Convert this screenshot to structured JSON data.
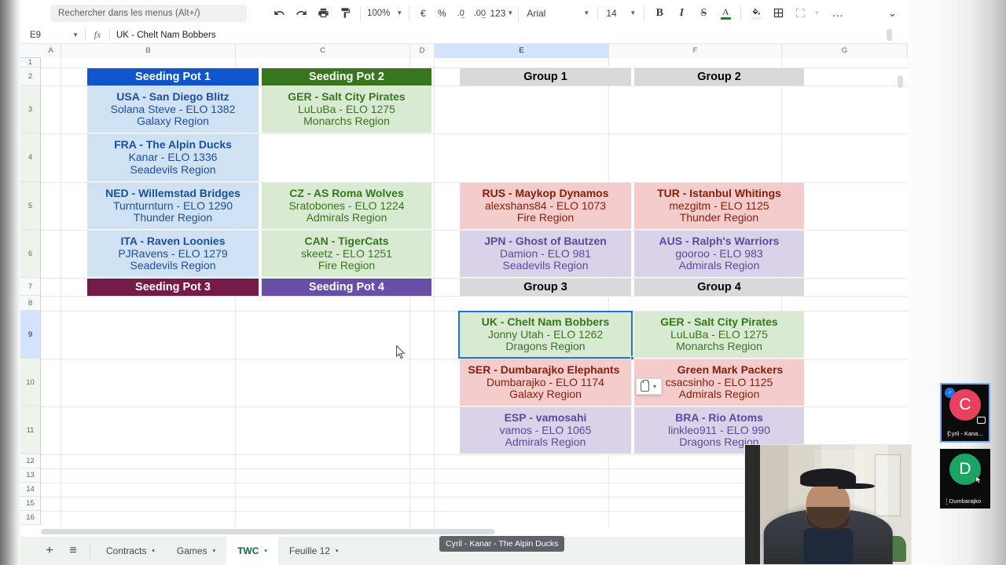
{
  "toolbar": {
    "search_placeholder": "Rechercher dans les menus (Alt+/)",
    "undo": "↶",
    "redo": "↷",
    "print": "print-icon",
    "paint": "paint-format-icon",
    "zoom": "100%",
    "currency": "€",
    "percent": "%",
    "dec_decrease": ".0",
    "dec_increase": ".00",
    "formats": "123",
    "font": "Arial",
    "font_size": "14",
    "bold": "B",
    "italic": "I",
    "strikethrough": "S",
    "text_color": "A",
    "fill_color": "fill-color-icon",
    "borders": "borders-icon",
    "merge": "merge-cells-icon",
    "more": "…",
    "collapse": "⌄"
  },
  "formula_bar": {
    "name_box": "E9",
    "fx": "fx",
    "value": "UK - Chelt Nam Bobbers"
  },
  "grid": {
    "columns": [
      "A",
      "B",
      "C",
      "D",
      "E",
      "F",
      "G"
    ],
    "active_column": "E",
    "rows": [
      "1",
      "2",
      "3",
      "4",
      "5",
      "6",
      "7",
      "8",
      "9",
      "10",
      "11",
      "12",
      "13",
      "14",
      "15",
      "16"
    ],
    "active_row": "9"
  },
  "pots": [
    {
      "title": "Seeding Pot 1",
      "header_color": "#1155cc",
      "teams": [
        {
          "name": "USA - San Diego Blitz",
          "player": "Solana Steve - ELO 1382",
          "region": "Galaxy Region"
        },
        {
          "name": "FRA - The Alpin Ducks",
          "player": "Kanar - ELO 1336",
          "region": "Seadevils Region"
        },
        {
          "name": "NED - Willemstad Bridges",
          "player": "Turnturnturn - ELO 1290",
          "region": "Thunder Region"
        },
        {
          "name": "ITA - Raven Loonies",
          "player": "PJRavens - ELO 1279",
          "region": "Seadevils Region"
        }
      ]
    },
    {
      "title": "Seeding Pot 2",
      "header_color": "#38761d",
      "teams": [
        {
          "name": "GER - Salt City Pirates",
          "player": "LuLuBa - ELO 1275",
          "region": "Monarchs Region"
        },
        {
          "name": "",
          "player": "",
          "region": ""
        },
        {
          "name": "CZ - AS Roma Wolves",
          "player": "Sratobones - ELO 1224",
          "region": "Admirals Region"
        },
        {
          "name": "CAN - TigerCats",
          "player": "skeetz - ELO 1251",
          "region": "Fire Region"
        }
      ]
    },
    {
      "title": "Seeding Pot 3",
      "header_color": "#741b47",
      "teams": []
    },
    {
      "title": "Seeding Pot 4",
      "header_color": "#674ea7",
      "teams": []
    }
  ],
  "groups": [
    {
      "title": "Group 1",
      "teams": [
        {
          "name": "RUS - Maykop Dynamos",
          "player": "alexshans84 - ELO 1073",
          "region": "Fire Region"
        },
        {
          "name": "JPN - Ghost of Bautzen",
          "player": "Damion - ELO 981",
          "region": "Seadevils Region"
        }
      ]
    },
    {
      "title": "Group 2",
      "teams": [
        {
          "name": "TUR - Istanbul Whitings",
          "player": "mezgitm - ELO 1125",
          "region": "Thunder Region"
        },
        {
          "name": "AUS - Ralph's Warriors",
          "player": "gooroo - ELO 983",
          "region": "Admirals Region"
        }
      ]
    },
    {
      "title": "Group 3",
      "teams": [
        {
          "name": "UK - Chelt Nam Bobbers",
          "player": "Jonny Utah - ELO 1262",
          "region": "Dragons Region"
        },
        {
          "name": "SER - Dumbarajko Elephants",
          "player": "Dumbarajko - ELO 1174",
          "region": "Galaxy Region"
        },
        {
          "name": "ESP - vamosahi",
          "player": "vamos - ELO 1065",
          "region": "Admirals Region"
        }
      ]
    },
    {
      "title": "Group 4",
      "teams": [
        {
          "name": "GER - Salt City Pirates",
          "player": "LuLuBa - ELO 1275",
          "region": "Monarchs Region"
        },
        {
          "name": "Green Mark Packers",
          "player": "csacsinho - ELO 1125",
          "region": "Admirals Region"
        },
        {
          "name": "BRA - Rio Atoms",
          "player": "linkleo911 - ELO 990",
          "region": "Dragons Region"
        }
      ]
    }
  ],
  "paste_popup": {
    "icon": "clipboard-icon",
    "caret": "▾"
  },
  "sheet_tabs": {
    "add": "+",
    "all_sheets": "≡",
    "tabs": [
      {
        "label": "Contracts",
        "active": false
      },
      {
        "label": "Games",
        "active": false
      },
      {
        "label": "TWC",
        "active": true
      },
      {
        "label": "Feuille 12",
        "active": false
      }
    ],
    "caret": "▾"
  },
  "tooltip": {
    "text": "Cyril - Kanar - The Alpin Ducks"
  },
  "participants": [
    {
      "initial": "C",
      "name": "Cyril - Kana...",
      "avatar_color": "#e8415e",
      "active": true
    },
    {
      "initial": "D",
      "name": "Dumbarajko",
      "avatar_color": "#1aa563",
      "active": false
    }
  ],
  "colors": {
    "pot1_bg": "#cfe2f3",
    "pot1_text": "#1155cc",
    "pot2_bg": "#d9ead3",
    "pot2_text": "#38761d",
    "group_header_bg": "#d9d9d9",
    "pink_bg": "#f4cccc",
    "pink_text": "#85200c",
    "purple_bg": "#d9d2e9",
    "purple_text": "#674ea7",
    "selection": "#1a73e8"
  }
}
